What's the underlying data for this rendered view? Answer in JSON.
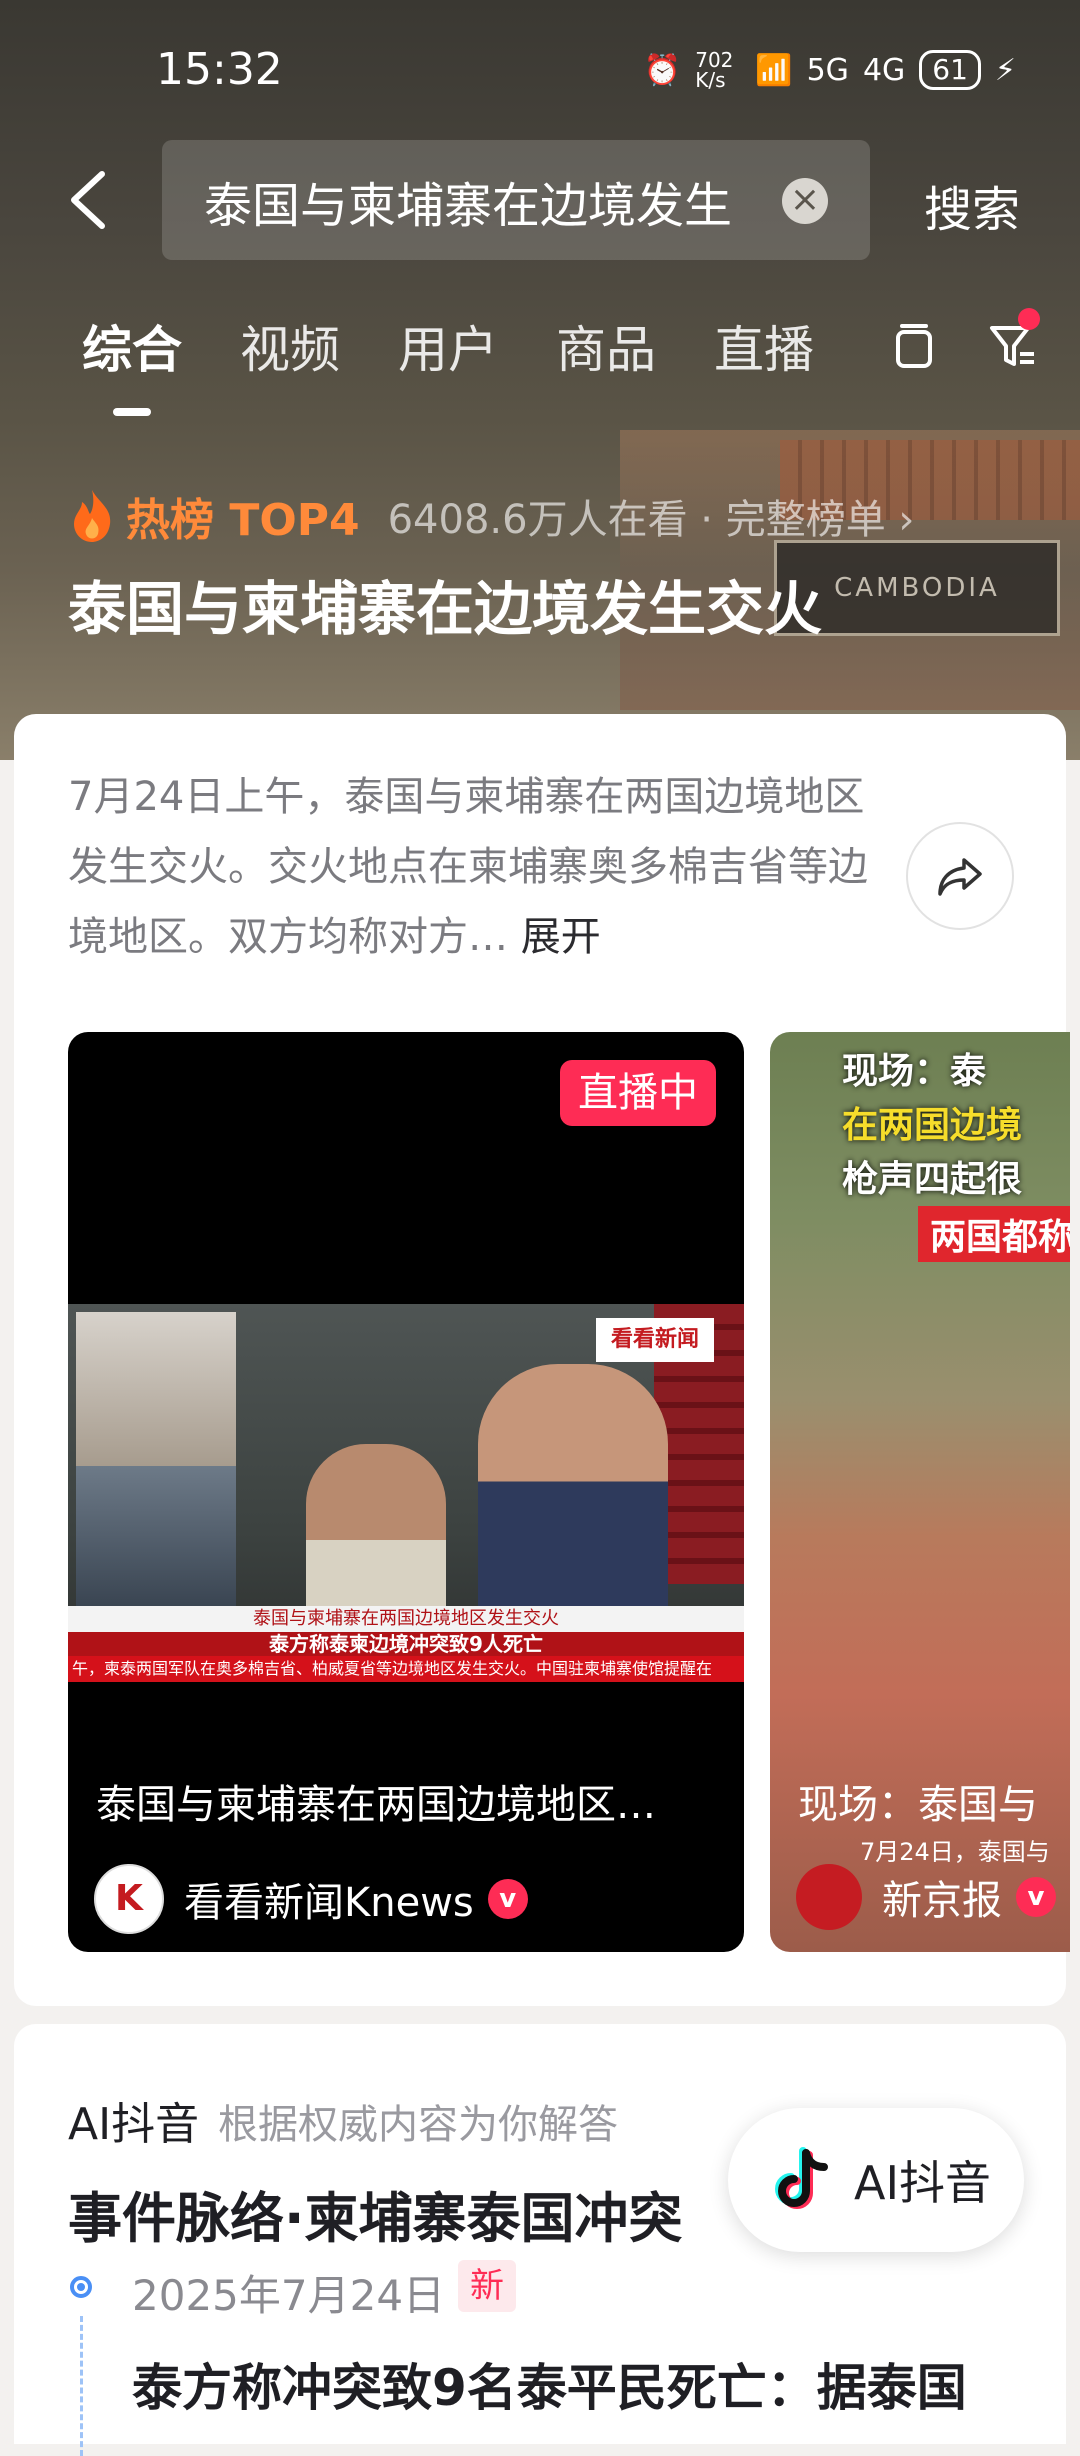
{
  "status_bar": {
    "time": "15:32",
    "net_speed": "702 K/s",
    "signal1": "5G",
    "signal2": "4G",
    "battery": "61"
  },
  "search": {
    "query": "泰国与柬埔寨在边境发生",
    "action_label": "搜索"
  },
  "tabs": [
    "综合",
    "视频",
    "用户",
    "商品",
    "直播"
  ],
  "hot": {
    "rank": "热榜 TOP4",
    "views": "6408.6万人在看 · 完整榜单 ›",
    "title": "泰国与柬埔寨在边境发生交火"
  },
  "background_sign": "CAMBODIA",
  "summary": {
    "text": "7月24日上午，泰国与柬埔寨在两国边境地区发生交火。交火地点在柬埔寨奥多棉吉省等边境地区。双方均称对方…",
    "expand": " 展开"
  },
  "videos": [
    {
      "badge": "直播中",
      "title": "泰国与柬埔寨在两国边境地区…",
      "author": "看看新闻Knews",
      "frame": {
        "logo": "看看新闻",
        "ticker_top": "泰国与柬埔寨在两国边境地区发生交火",
        "ticker_main": "泰方称泰柬边境冲突致9人死亡",
        "ticker_scroll": "午，柬泰两国军队在奥多棉吉省、柏威夏省等边境地区发生交火。中国驻柬埔寨使馆提醒在"
      }
    },
    {
      "captions": [
        "现场：泰",
        "在两国边境",
        "枪声四起很",
        "两国都称"
      ],
      "title": "现场：泰国与",
      "date_caption": "7月24日，泰国与",
      "author": "新京报"
    }
  ],
  "ai": {
    "label": "AI抖音",
    "sub": "根据权威内容为你解答",
    "title": "事件脉络·柬埔寨泰国冲突",
    "timeline_date": "2025年7月24日",
    "new_badge": "新",
    "timeline_text": "泰方称冲突致9名泰平民死亡：据泰国",
    "fab_label": "AI抖音"
  },
  "colors": {
    "accent": "#fe2c55",
    "hot": "#ff8a3a",
    "timeline": "#4a8ff5"
  },
  "icons": [
    "back-icon",
    "clear-icon",
    "layout-icon",
    "filter-icon",
    "flame-icon",
    "share-icon",
    "verified-icon",
    "douyin-icon"
  ]
}
